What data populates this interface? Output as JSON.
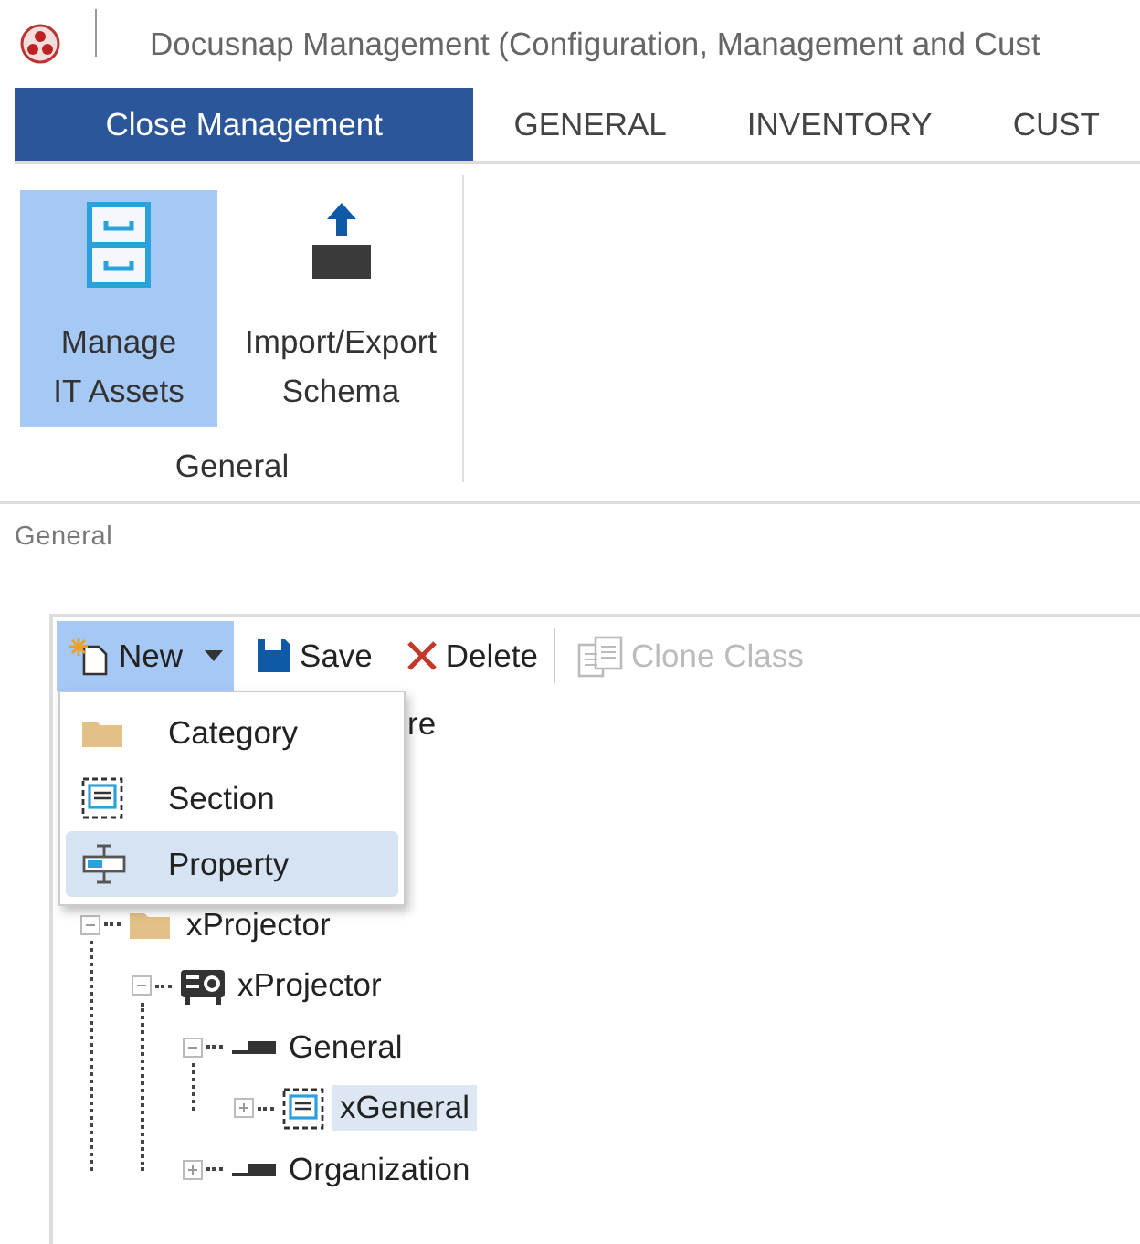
{
  "window": {
    "title": "Docusnap Management (Configuration, Management and Cust"
  },
  "ribbon_tabs": [
    {
      "label": "Close Management",
      "kind": "close"
    },
    {
      "label": "GENERAL",
      "kind": "tab"
    },
    {
      "label": "INVENTORY",
      "kind": "tab"
    },
    {
      "label": "CUST",
      "kind": "tab"
    }
  ],
  "ribbon_groups": [
    {
      "label": "General",
      "buttons": [
        {
          "label": "Manage\nIT Assets",
          "kind": "cabinet",
          "selected": true
        },
        {
          "label": "Import/Export\nSchema",
          "kind": "upload",
          "selected": false
        }
      ]
    }
  ],
  "section_label": "General",
  "toolbar": [
    {
      "kind": "new",
      "label": "New",
      "selected": true,
      "disabled": false
    },
    {
      "kind": "save",
      "label": "Save",
      "selected": false,
      "disabled": false
    },
    {
      "kind": "delete",
      "label": "Delete",
      "selected": false,
      "disabled": false
    },
    {
      "kind": "separator"
    },
    {
      "kind": "clone",
      "label": "Clone Class",
      "selected": false,
      "disabled": true
    }
  ],
  "new_menu": [
    {
      "label": "Category",
      "kind": "folder",
      "selected": false
    },
    {
      "label": "Section",
      "kind": "section",
      "selected": false
    },
    {
      "label": "Property",
      "kind": "property",
      "selected": true
    }
  ],
  "tree": [
    {
      "label": "re",
      "selected": false,
      "children": [
        {
          "label": "xProjector",
          "kind": "folder",
          "expanded": true,
          "selected": false,
          "children": [
            {
              "label": "xProjector",
              "kind": "projector",
              "expanded": true,
              "selected": false,
              "children": [
                {
                  "label": "General",
                  "kind": "bar",
                  "expanded": true,
                  "selected": false,
                  "children": [
                    {
                      "label": "xGeneral",
                      "kind": "section",
                      "expanded": false,
                      "selected": true
                    }
                  ]
                },
                {
                  "label": "Organization",
                  "kind": "bar",
                  "expanded": false,
                  "selected": false
                }
              ]
            }
          ]
        }
      ]
    }
  ]
}
